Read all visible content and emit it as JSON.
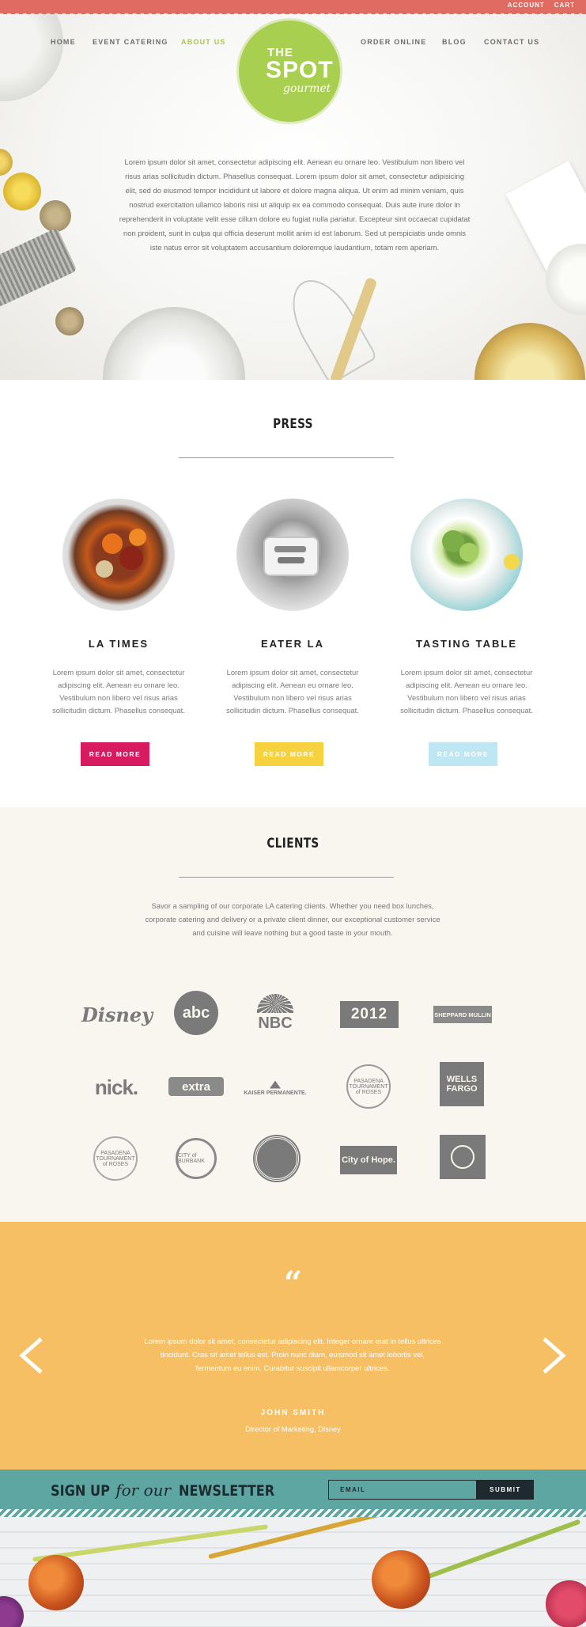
{
  "header": {
    "util_links": [
      "ACCOUNT",
      "CART"
    ],
    "nav": [
      "HOME",
      "EVENT CATERING",
      "ABOUT US",
      "ORDER ONLINE",
      "BLOG",
      "CONTACT US"
    ],
    "active_nav": "ABOUT US",
    "logo": {
      "line1": "THE",
      "line2": "SPOT",
      "line3": "gourmet"
    }
  },
  "hero": {
    "text": "Lorem ipsum dolor sit amet, consectetur adipiscing elit. Aenean eu ornare leo. Vestibulum non libero vel risus arias sollicitudin dictum. Phasellus consequat. Lorem ipsum dolor sit amet, consectetur adipisicing elit, sed do eiusmod tempor incididunt ut labore et dolore magna aliqua. Ut enim ad minim veniam, quis nostrud exercitation ullamco laboris nisi ut aliquip ex ea commodo consequat. Duis aute irure dolor in reprehenderit in voluptate velit esse cillum dolore eu fugiat nulla pariatur. Excepteur sint occaecat cupidatat non proident, sunt in culpa qui officia deserunt mollit anim id est laborum. Sed ut perspiciatis unde omnis iste natus error sit voluptatem accusantium doloremque laudantium, totam rem aperiam."
  },
  "press": {
    "title": "PRESS",
    "items": [
      {
        "name": "LA TIMES",
        "desc": "Lorem ipsum dolor sit amet, consectetur adipiscing elit. Aenean eu ornare leo. Vestibulum non libero vel risus arias sollicitudin dictum. Phasellus consequat.",
        "button": "READ MORE",
        "color": "#d81b60"
      },
      {
        "name": "EATER LA",
        "desc": "Lorem ipsum dolor sit amet, consectetur adipiscing elit. Aenean eu ornare leo. Vestibulum non libero vel risus arias sollicitudin dictum. Phasellus consequat.",
        "button": "READ MORE",
        "color": "#f6d23e"
      },
      {
        "name": "TASTING TABLE",
        "desc": "Lorem ipsum dolor sit amet, consectetur adipiscing elit. Aenean eu ornare leo. Vestibulum non libero vel risus arias sollicitudin dictum. Phasellus consequat.",
        "button": "READ MORE",
        "color": "#bfe6f3"
      }
    ]
  },
  "clients": {
    "title": "CLIENTS",
    "text": "Savor a sampling of our corporate LA catering clients. Whether you need box lunches, corporate catering and delivery or a private client dinner, our exceptional customer service and cuisine will leave nothing but a good taste in your mouth.",
    "logos": {
      "disney": "Disney",
      "abc": "abc",
      "nbc": "NBC",
      "londonOlympics": "2012",
      "sheppard": "SHEPPARD MULLIN",
      "nick": "nick.",
      "extra": "extra",
      "kaiser": "KAISER PERMANENTE.",
      "rose1": "PASADENA TOURNAMENT of ROSES",
      "wells": "WELLS FARGO",
      "rose2": "PASADENA TOURNAMENT of ROSES",
      "burbank": "CITY of BURBANK",
      "hope": "City of Hope."
    }
  },
  "testimonial": {
    "quote_mark": "“",
    "text": "Lorem ipsum dolor sit amet, consectetur adipiscing elit. Integer ornare erat in tellus ultrices tincidunt. Cras sit amet tellus est. Proin nunc diam, euismod sit amet lobortis vel, fermentum eu enim. Curabitur suscipit ullamcorper ultrices.",
    "name": "JOHN SMITH",
    "role": "Director of Marketing, Disney"
  },
  "newsletter": {
    "label_a": "SIGN UP",
    "label_b": "for our",
    "label_c": "NEWSLETTER",
    "placeholder": "EMAIL",
    "submit": "SUBMIT"
  },
  "colors": {
    "accent_red": "#e06b63",
    "logo_green": "#a8cf4f",
    "testimonial_bg": "#f6bf63",
    "newsletter_bg": "#5ea6a2"
  }
}
